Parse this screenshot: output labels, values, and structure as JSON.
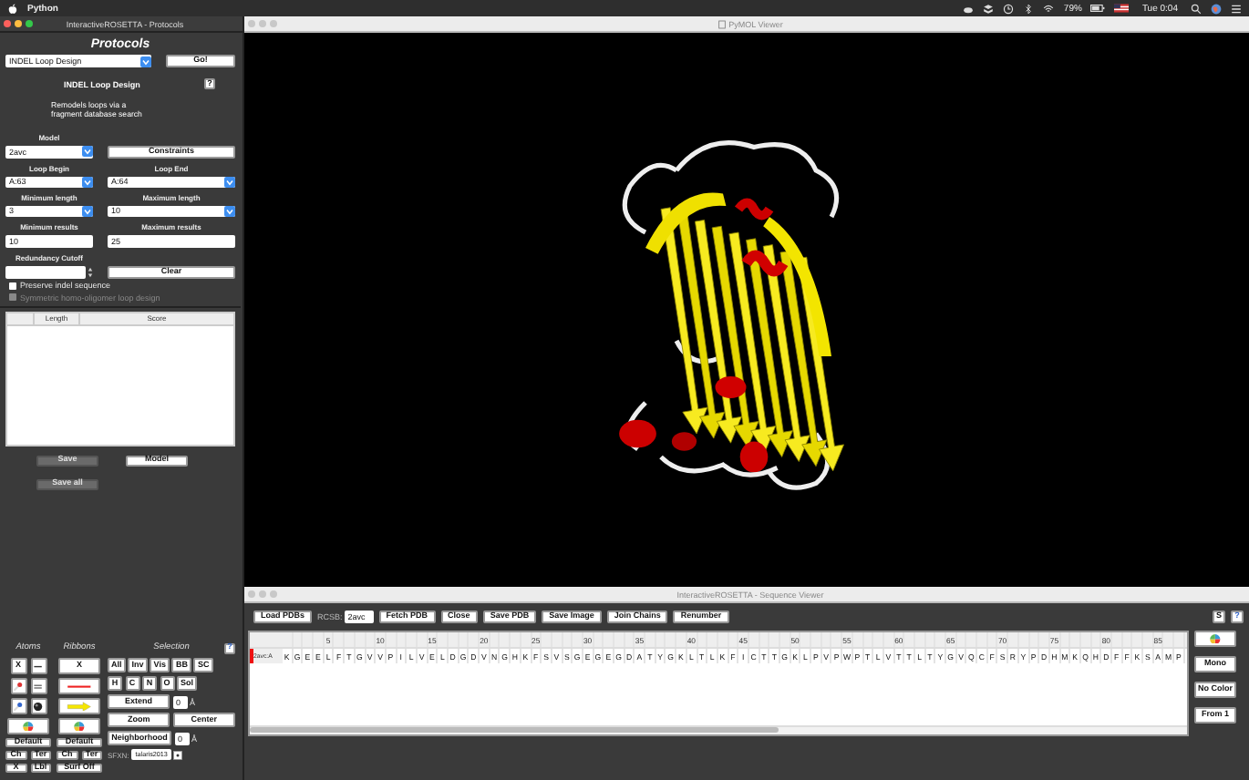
{
  "menu_bar": {
    "app": "Python",
    "battery": "79%",
    "clock": "Tue 0:04"
  },
  "protocols_window": {
    "title": "InteractiveROSETTA - Protocols",
    "heading": "Protocols",
    "protocol": "INDEL Loop Design",
    "go_button": "Go!"
  },
  "loop_design": {
    "title": "INDEL Loop Design",
    "help_button": "?",
    "description_lines": [
      "Remodels loops via a",
      "fragment database search"
    ],
    "form_rows": [
      [
        {
          "kind": "select",
          "label": "Model",
          "value": "2avc"
        },
        {
          "kind": "button",
          "value": "Constraints"
        }
      ],
      [
        {
          "kind": "select",
          "label": "Loop Begin",
          "value": "A:63"
        },
        {
          "kind": "select",
          "label": "Loop End",
          "value": "A:64"
        }
      ],
      [
        {
          "kind": "select",
          "label": "Minimum length",
          "value": "3"
        },
        {
          "kind": "select",
          "label": "Maximum length",
          "value": "10"
        }
      ],
      [
        {
          "kind": "field",
          "label": "Minimum results",
          "value": "10"
        },
        {
          "kind": "field",
          "label": "Maximum results",
          "value": "25"
        }
      ],
      [
        {
          "kind": "spinner",
          "label": "Redundancy Cutoff"
        },
        {
          "kind": "button",
          "value": "Clear"
        }
      ]
    ],
    "checkboxes": [
      {
        "label": "Preserve indel sequence",
        "checked": false,
        "disabled": false
      },
      {
        "label": "Symmetric homo-oligomer loop design",
        "checked": false,
        "disabled": true
      }
    ],
    "results_table": {
      "columns": [
        "Length",
        "Score"
      ]
    },
    "buttons": [
      {
        "label": "Save",
        "disabled": true
      },
      {
        "label": "Model",
        "disabled": false
      },
      {
        "label": "Save all",
        "disabled": true
      }
    ]
  },
  "view_controls": {
    "atoms": {
      "heading": "Atoms",
      "hide": "X",
      "default": "Default",
      "small": [
        "Ch",
        "Ter",
        "X",
        "Lbl"
      ]
    },
    "ribbons": {
      "heading": "Ribbons",
      "hide": "X",
      "default": "Default",
      "small": [
        "Ch",
        "Ter",
        "Surf Off"
      ]
    },
    "selection": {
      "heading": "Selection",
      "help_button": "?",
      "row_1": [
        "All",
        "Inv",
        "Vis",
        "BB",
        "SC"
      ],
      "row_2": [
        "H",
        "C",
        "N",
        "O",
        "Sol"
      ],
      "extend": "Extend",
      "extend_value": "0",
      "extend_unit": "Å",
      "zoom": "Zoom",
      "center": "Center",
      "neighborhood": "Neighborhood",
      "neighborhood_value": "0",
      "neighborhood_unit": "Å",
      "sfxn_label": "SFXN:",
      "sfxn": "talaris2013"
    }
  },
  "pymol_viewer": {
    "title": "PyMOL Viewer"
  },
  "sequence_viewer": {
    "title": "InteractiveROSETTA - Sequence Viewer",
    "toolbar": [
      {
        "kind": "button",
        "label": "Load PDBs"
      },
      {
        "kind": "label",
        "label": "RCSB:"
      },
      {
        "kind": "field",
        "label": "2avc"
      },
      {
        "kind": "button",
        "label": "Fetch PDB"
      },
      {
        "kind": "button",
        "label": "Close"
      },
      {
        "kind": "button",
        "label": "Save PDB"
      },
      {
        "kind": "button",
        "label": "Save Image"
      },
      {
        "kind": "button",
        "label": "Join Chains"
      },
      {
        "kind": "button",
        "label": "Renumber"
      }
    ],
    "corner_buttons": [
      "S",
      "?"
    ],
    "ticks": [
      "5",
      "10",
      "15",
      "20",
      "25",
      "30",
      "35",
      "40",
      "45",
      "50",
      "55",
      "60",
      "65",
      "70",
      "75",
      "80",
      "85"
    ],
    "chain_label": "2avc:A",
    "residues": [
      "K",
      "G",
      "E",
      "E",
      "L",
      "F",
      "T",
      "G",
      "V",
      "V",
      "P",
      "I",
      "L",
      "V",
      "E",
      "L",
      "D",
      "G",
      "D",
      "V",
      "N",
      "G",
      "H",
      "K",
      "F",
      "S",
      "V",
      "S",
      "G",
      "E",
      "G",
      "E",
      "G",
      "D",
      "A",
      "T",
      "Y",
      "G",
      "K",
      "L",
      "T",
      "L",
      "K",
      "F",
      "I",
      "C",
      "T",
      "T",
      "G",
      "K",
      "L",
      "P",
      "V",
      "P",
      "W",
      "P",
      "T",
      "L",
      "V",
      "T",
      "T",
      "L",
      "T",
      "Y",
      "G",
      "V",
      "Q",
      "C",
      "F",
      "S",
      "R",
      "Y",
      "P",
      "D",
      "H",
      "M",
      "K",
      "Q",
      "H",
      "D",
      "F",
      "F",
      "K",
      "S",
      "A",
      "M",
      "P"
    ],
    "side_buttons": [
      "Mono",
      "No Color",
      "From 1"
    ]
  }
}
